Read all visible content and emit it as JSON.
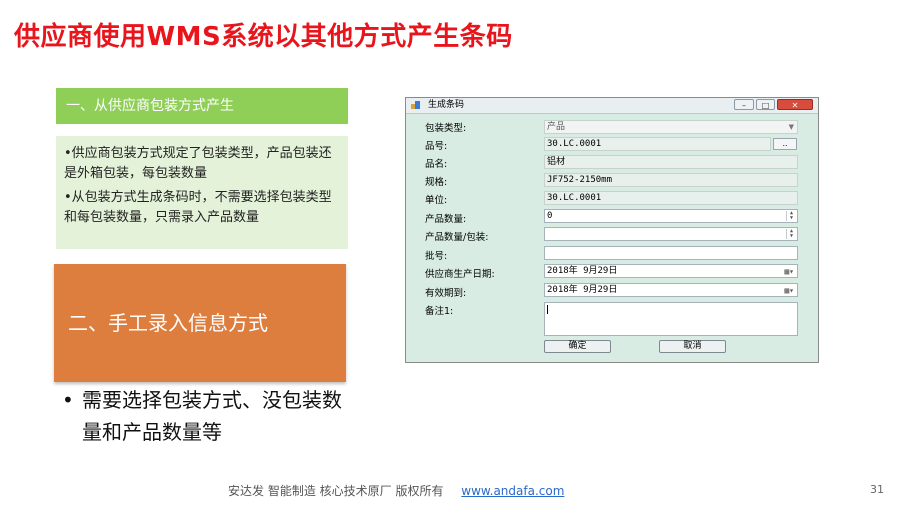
{
  "slide": {
    "title": "供应商使用WMS系统以其他方式产生条码",
    "section1_heading": "一、从供应商包装方式产生",
    "section1_points": [
      "•供应商包装方式规定了包装类型，产品包装还是外箱包装，每包装数量",
      "•从包装方式生成条码时，不需要选择包装类型和每包装数量，只需录入产品数量"
    ],
    "section2_heading": "二、手工录入信息方式",
    "bullet_symbol": "•",
    "bullet_text": "需要选择包装方式、没包装数量和产品数量等",
    "footer_text": "安达发  智能制造 核心技术原厂   版权所有",
    "footer_link": "www.andafa.com",
    "page_number": "31"
  },
  "dialog": {
    "title": "生成条码",
    "min_label": "–",
    "max_label": "□",
    "close_label": "✕",
    "fields": {
      "package_type": {
        "label": "包装类型:",
        "value": "产品"
      },
      "item_no": {
        "label": "品号:",
        "value": "30.LC.0001"
      },
      "item_name": {
        "label": "品名:",
        "value": "铝材"
      },
      "spec": {
        "label": "规格:",
        "value": "JF752-2150mm"
      },
      "unit": {
        "label": "单位:",
        "value": "30.LC.0001"
      },
      "quantity": {
        "label": "产品数量:",
        "value": "0"
      },
      "qty_per_pack": {
        "label": "产品数量/包装:",
        "value": ""
      },
      "batch_no": {
        "label": "批号:",
        "value": ""
      },
      "production_date": {
        "label": "供应商生产日期:",
        "value": "2018年  9月29日"
      },
      "expiry_date": {
        "label": "有效期到:",
        "value": "2018年  9月29日"
      },
      "remark": {
        "label": "备注1:",
        "value": ""
      }
    },
    "browse_button": "..",
    "ok_button": "确定",
    "cancel_button": "取消"
  }
}
